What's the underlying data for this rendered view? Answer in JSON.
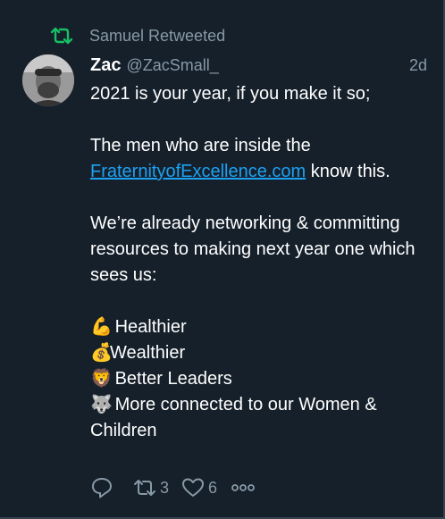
{
  "retweet": {
    "label": "Samuel Retweeted"
  },
  "tweet": {
    "name": "Zac",
    "handle": "@ZacSmall_",
    "time": "2d",
    "line1": "2021 is your year, if you make it so;",
    "line2": "The men who are inside the",
    "link": "FraternityofExcellence.com",
    "line2_after": " know this.",
    "line3": "We’re already networking & committing resources to making next year one which sees us:",
    "list": [
      {
        "emoji": "💪",
        "text": "Healthier"
      },
      {
        "emoji": "💰",
        "text": "Wealthier"
      },
      {
        "emoji": "🦁",
        "text": "Better Leaders"
      },
      {
        "emoji": "🐺",
        "text": "More connected to our Women & Children"
      }
    ]
  },
  "actions": {
    "retweets": "3",
    "likes": "6"
  },
  "colors": {
    "background": "#15202b",
    "retweet_green": "#17bf63",
    "muted": "#8899a6",
    "link": "#1da1f2"
  },
  "icons": [
    "retweet-icon",
    "reply-icon",
    "like-icon",
    "more-icon"
  ]
}
